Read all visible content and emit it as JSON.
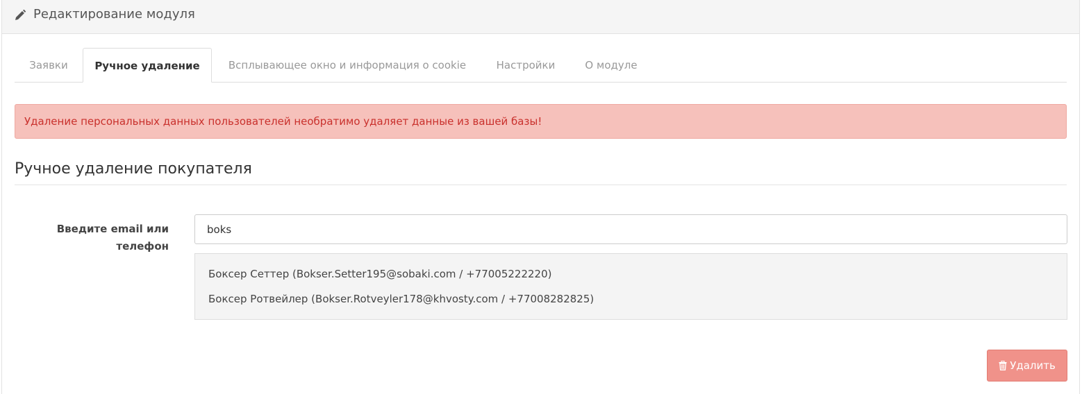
{
  "header": {
    "icon": "pencil-icon",
    "title": "Редактирование модуля"
  },
  "tabs": [
    {
      "label": "Заявки",
      "active": false
    },
    {
      "label": "Ручное удаление",
      "active": true
    },
    {
      "label": "Всплывающее окно и информация о cookie",
      "active": false
    },
    {
      "label": "Настройки",
      "active": false
    },
    {
      "label": "О модуле",
      "active": false
    }
  ],
  "alert": {
    "text": "Удаление персональных данных пользователей необратимо удаляет данные из вашей базы!"
  },
  "section": {
    "title": "Ручное удаление покупателя"
  },
  "form": {
    "label_line1": "Введите email или",
    "label_line2": "телефон",
    "search_value": "boks"
  },
  "results": [
    "Боксер Сеттер (Bokser.Setter195@sobaki.com / +77005222220)",
    "Боксер Ротвейлер (Bokser.Rotveyler178@khvosty.com / +77008282825)"
  ],
  "actions": {
    "delete_label": "Удалить",
    "delete_icon": "trash-icon"
  },
  "colors": {
    "alert_bg": "#f6c1bb",
    "alert_text": "#c9302c",
    "delete_bg": "#f0928a"
  }
}
